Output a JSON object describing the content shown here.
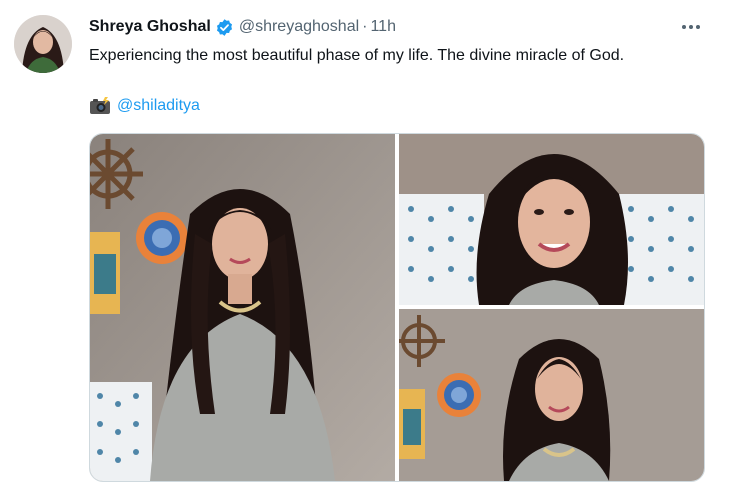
{
  "tweet": {
    "author_name": "Shreya Ghoshal",
    "handle": "@shreyaghoshal",
    "separator": "·",
    "time": "11h",
    "text": "Experiencing the most beautiful phase of my life. The divine miracle of God.",
    "photo_credit_icon": "camera-with-flash",
    "photo_credit_mention": "@shiladitya",
    "verified": true
  },
  "colors": {
    "text": "#0f1419",
    "secondary": "#536471",
    "accent": "#1d9bf0",
    "border": "#cfd9de"
  },
  "media": {
    "count": 3
  }
}
